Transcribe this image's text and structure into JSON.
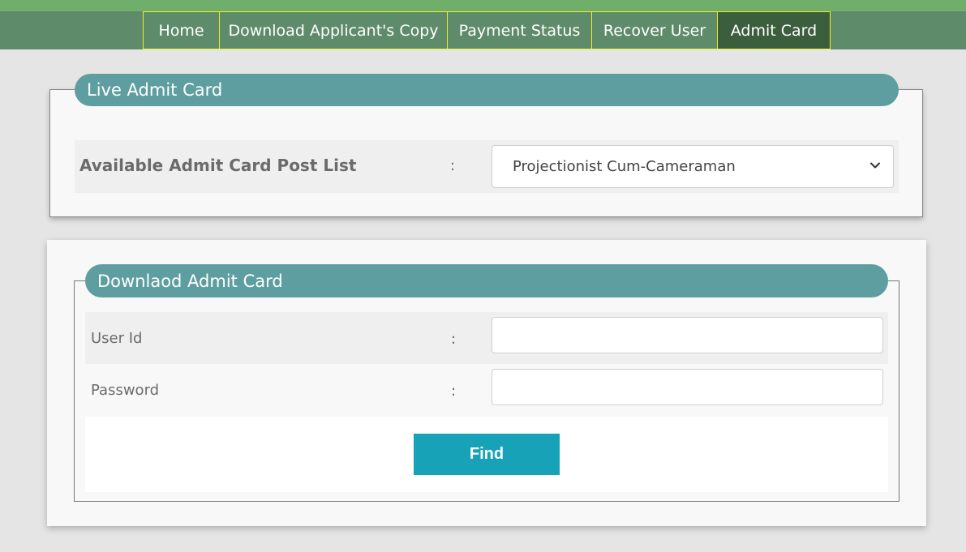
{
  "nav": {
    "items": [
      {
        "label": "Home",
        "active": false
      },
      {
        "label": "Download Applicant's Copy",
        "active": false
      },
      {
        "label": "Payment Status",
        "active": false
      },
      {
        "label": "Recover User",
        "active": false
      },
      {
        "label": "Admit Card",
        "active": true
      }
    ]
  },
  "live_admit_card": {
    "title": "Live Admit Card",
    "post_list_label": "Available Admit Card Post List",
    "separator": ":",
    "selected_post": "Projectionist Cum-Cameraman"
  },
  "download_admit_card": {
    "title": "Downlaod Admit Card",
    "user_id_label": "User Id",
    "password_label": "Password",
    "separator": ":",
    "user_id_value": "",
    "password_value": "",
    "find_label": "Find"
  },
  "colors": {
    "top_strip": "#6fae6b",
    "navbar": "#5e8c6a",
    "nav_active": "#3b5e3d",
    "nav_border": "#f0f020",
    "legend": "#5f9ea0",
    "button": "#17a2b8"
  }
}
